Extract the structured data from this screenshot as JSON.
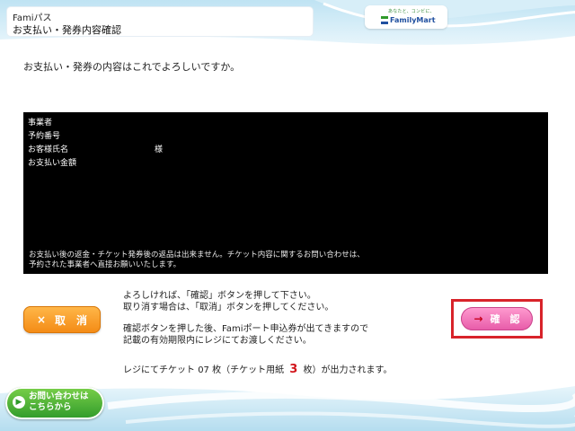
{
  "header": {
    "title_line1": "Famiパス",
    "title_line2": "お支払い・発券内容確認",
    "logo_tagline": "あなたと、コンビに、",
    "logo_name": "FamilyMart"
  },
  "prompt": "お支払い・発券の内容はこれでよろしいですか。",
  "details": {
    "rows": [
      {
        "label": "事業者",
        "value": ""
      },
      {
        "label": "予約番号",
        "value": ""
      },
      {
        "label": "お客様氏名",
        "value": "",
        "suffix": "様"
      },
      {
        "label": "お支払い金額",
        "value": ""
      }
    ],
    "notice_line1": "お支払い後の返金・チケット発券後の返品は出来ません。チケット内容に関するお問い合わせは、",
    "notice_line2": "予約された事業者へ直接お願いいたします。"
  },
  "buttons": {
    "cancel_mark": "×",
    "cancel_label": "取　消",
    "confirm_arrow": "→",
    "confirm_label": "確　認"
  },
  "instructions": {
    "line1": "よろしければ、「確認」ボタンを押して下さい。",
    "line2": "取り消す場合は、「取消」ボタンを押してください。",
    "line3": "確認ボタンを押した後、Famiポート申込券が出てきますので",
    "line4": "記載の有効期限内にレジにてお渡しください。"
  },
  "output": {
    "prefix": "レジにてチケット",
    "ticket_count": "07",
    "mid": "枚（チケット用紙",
    "paper_count": "3",
    "suffix": "枚）が出力されます。"
  },
  "inquiry_button": {
    "line1": "お問い合わせは",
    "line2": "こちらから"
  },
  "colors": {
    "accent_red": "#d8232a",
    "cancel_orange": "#f38a14",
    "confirm_pink": "#e75aa8",
    "inquiry_green": "#2f9a2a",
    "brand_blue": "#1f4f9f"
  }
}
